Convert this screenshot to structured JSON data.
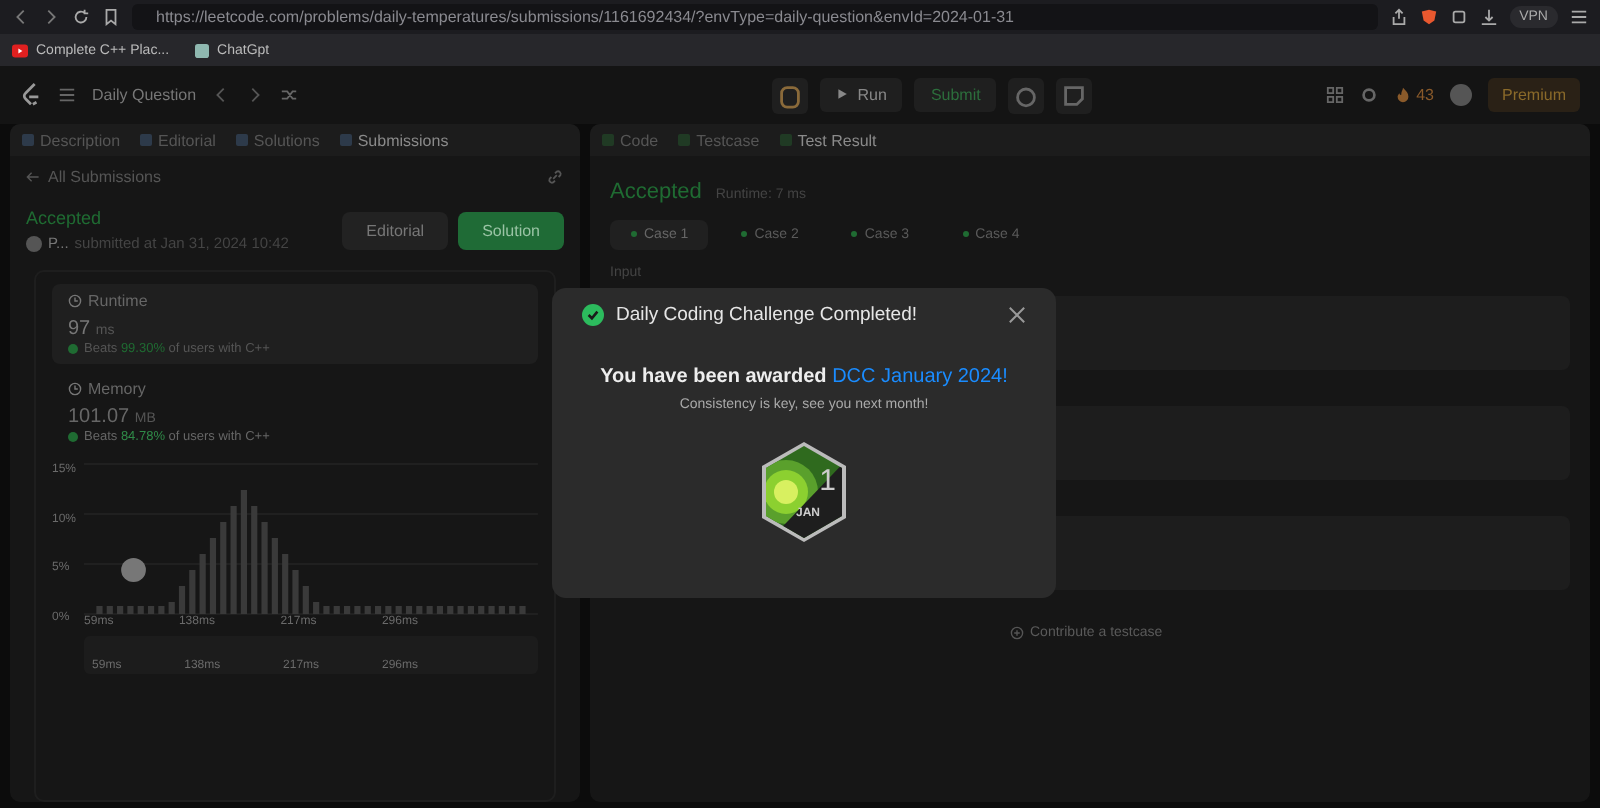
{
  "browser": {
    "url": "https://leetcode.com/problems/daily-temperatures/submissions/1161692434/?envType=daily-question&envId=2024-01-31",
    "vpn": "VPN"
  },
  "bookmarks": [
    {
      "label": "Complete C++ Plac...",
      "kind": "video"
    },
    {
      "label": "ChatGpt",
      "kind": "app"
    }
  ],
  "header": {
    "title": "Daily Question",
    "run": "Run",
    "submit": "Submit",
    "streak": "43",
    "premium": "Premium"
  },
  "left_tabs": [
    {
      "label": "Description",
      "selected": false
    },
    {
      "label": "Editorial",
      "selected": false
    },
    {
      "label": "Solutions",
      "selected": false
    },
    {
      "label": "Submissions",
      "selected": true
    }
  ],
  "back_link": "All Submissions",
  "submission": {
    "status": "Accepted",
    "author": "P...",
    "submitted": "submitted at Jan 31, 2024 10:42",
    "buttons": [
      {
        "label": "Editorial",
        "kind": "secondary"
      },
      {
        "label": "Solution",
        "kind": "primary"
      }
    ]
  },
  "stats": [
    {
      "title": "Runtime",
      "value": "97",
      "unit": "ms",
      "beats": "Beats",
      "percent": "99.30%",
      "suffix": "of users with C++",
      "active": true
    },
    {
      "title": "Memory",
      "value": "101.07",
      "unit": "MB",
      "beats": "Beats",
      "percent": "84.78%",
      "suffix": "of users with C++",
      "active": false
    }
  ],
  "memory_chart": {
    "y_labels": [
      "15%",
      "10%",
      "5%",
      "0%"
    ],
    "x_labels": [
      "59ms",
      "138ms",
      "217ms",
      "296ms"
    ],
    "minimap_labels": [
      "59ms",
      "138ms",
      "217ms",
      "296ms"
    ]
  },
  "right_tabs": [
    {
      "label": "Code",
      "selected": false
    },
    {
      "label": "Testcase",
      "selected": false
    },
    {
      "label": "Test Result",
      "selected": true
    }
  ],
  "result": {
    "status": "Accepted",
    "runtime": "Runtime: 7 ms",
    "cases": [
      {
        "label": "Case 1",
        "selected": true
      },
      {
        "label": "Case 2",
        "selected": false
      },
      {
        "label": "Case 3",
        "selected": false
      },
      {
        "label": "Case 4",
        "selected": false
      }
    ],
    "input_label": "Input",
    "contribute": "Contribute a testcase"
  },
  "modal": {
    "title": "Daily Coding Challenge Completed!",
    "awarded": "You have been awarded",
    "award": "DCC January 2024!",
    "subtitle": "Consistency is key, see you next month!",
    "badge_day": "1",
    "badge_month": "JAN"
  }
}
